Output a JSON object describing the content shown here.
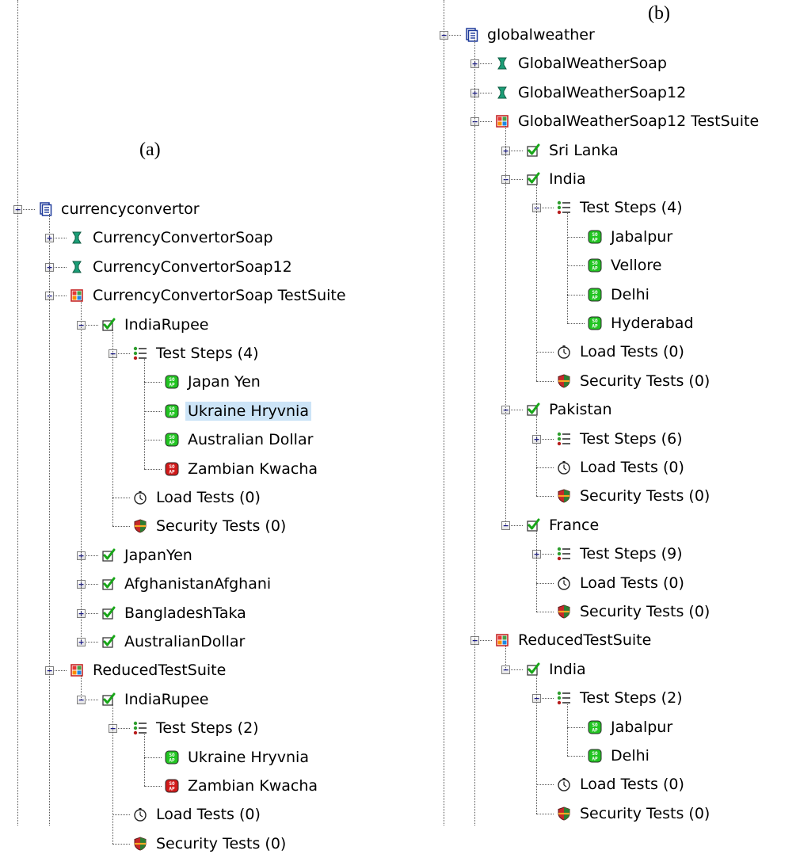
{
  "captions": {
    "a": "(a)",
    "b": "(b)"
  },
  "colors": {
    "selection": "#cce4f7",
    "pass": "#22c422",
    "fail": "#d11a1a",
    "suite": "#c62828",
    "interface": "#1b9e77"
  },
  "tree_a": [
    {
      "label": "currencyconvertor",
      "icon": "project-icon",
      "toggle": "minus"
    },
    {
      "label": "CurrencyConvertorSoap",
      "icon": "interface-icon",
      "toggle": "plus"
    },
    {
      "label": "CurrencyConvertorSoap12",
      "icon": "interface-icon",
      "toggle": "plus"
    },
    {
      "label": "CurrencyConvertorSoap TestSuite",
      "icon": "testsuite-icon",
      "toggle": "minus"
    },
    {
      "label": "IndiaRupee",
      "icon": "testcase-icon",
      "toggle": "minus"
    },
    {
      "label": "Test Steps (4)",
      "icon": "teststeps-icon",
      "toggle": "minus"
    },
    {
      "label": "Japan Yen",
      "icon": "soap-pass-icon"
    },
    {
      "label": "Ukraine Hryvnia",
      "icon": "soap-pass-icon",
      "selected": true
    },
    {
      "label": "Australian Dollar",
      "icon": "soap-pass-icon"
    },
    {
      "label": "Zambian Kwacha",
      "icon": "soap-fail-icon"
    },
    {
      "label": "Load Tests (0)",
      "icon": "stopwatch-icon"
    },
    {
      "label": "Security Tests (0)",
      "icon": "shield-icon"
    },
    {
      "label": "JapanYen",
      "icon": "testcase-icon",
      "toggle": "plus"
    },
    {
      "label": "AfghanistanAfghani",
      "icon": "testcase-icon",
      "toggle": "plus"
    },
    {
      "label": "BangladeshTaka",
      "icon": "testcase-icon",
      "toggle": "plus"
    },
    {
      "label": "AustralianDollar",
      "icon": "testcase-icon",
      "toggle": "plus"
    },
    {
      "label": "ReducedTestSuite",
      "icon": "testsuite-icon",
      "toggle": "minus"
    },
    {
      "label": "IndiaRupee",
      "icon": "testcase-icon",
      "toggle": "minus"
    },
    {
      "label": "Test Steps (2)",
      "icon": "teststeps-icon",
      "toggle": "minus"
    },
    {
      "label": "Ukraine Hryvnia",
      "icon": "soap-pass-icon"
    },
    {
      "label": "Zambian Kwacha",
      "icon": "soap-fail-icon"
    },
    {
      "label": "Load Tests (0)",
      "icon": "stopwatch-icon"
    },
    {
      "label": "Security Tests (0)",
      "icon": "shield-icon"
    }
  ],
  "tree_b": [
    {
      "label": "globalweather",
      "icon": "project-icon",
      "toggle": "minus"
    },
    {
      "label": "GlobalWeatherSoap",
      "icon": "interface-icon",
      "toggle": "plus"
    },
    {
      "label": "GlobalWeatherSoap12",
      "icon": "interface-icon",
      "toggle": "plus"
    },
    {
      "label": "GlobalWeatherSoap12 TestSuite",
      "icon": "testsuite-icon",
      "toggle": "minus"
    },
    {
      "label": "Sri Lanka",
      "icon": "testcase-icon",
      "toggle": "plus"
    },
    {
      "label": "India",
      "icon": "testcase-icon",
      "toggle": "minus"
    },
    {
      "label": "Test Steps (4)",
      "icon": "teststeps-icon",
      "toggle": "minus"
    },
    {
      "label": "Jabalpur",
      "icon": "soap-pass-icon"
    },
    {
      "label": "Vellore",
      "icon": "soap-pass-icon"
    },
    {
      "label": "Delhi",
      "icon": "soap-pass-icon"
    },
    {
      "label": "Hyderabad",
      "icon": "soap-pass-icon"
    },
    {
      "label": "Load Tests (0)",
      "icon": "stopwatch-icon"
    },
    {
      "label": "Security Tests (0)",
      "icon": "shield-icon"
    },
    {
      "label": "Pakistan",
      "icon": "testcase-icon",
      "toggle": "minus"
    },
    {
      "label": "Test Steps (6)",
      "icon": "teststeps-icon",
      "toggle": "plus"
    },
    {
      "label": "Load Tests (0)",
      "icon": "stopwatch-icon"
    },
    {
      "label": "Security Tests (0)",
      "icon": "shield-icon"
    },
    {
      "label": "France",
      "icon": "testcase-icon",
      "toggle": "minus"
    },
    {
      "label": "Test Steps (9)",
      "icon": "teststeps-icon",
      "toggle": "plus"
    },
    {
      "label": "Load Tests (0)",
      "icon": "stopwatch-icon"
    },
    {
      "label": "Security Tests (0)",
      "icon": "shield-icon"
    },
    {
      "label": "ReducedTestSuite",
      "icon": "testsuite-icon",
      "toggle": "minus"
    },
    {
      "label": "India",
      "icon": "testcase-icon",
      "toggle": "minus"
    },
    {
      "label": "Test Steps (2)",
      "icon": "teststeps-icon",
      "toggle": "minus"
    },
    {
      "label": "Jabalpur",
      "icon": "soap-pass-icon"
    },
    {
      "label": "Delhi",
      "icon": "soap-pass-icon"
    },
    {
      "label": "Load Tests (0)",
      "icon": "stopwatch-icon"
    },
    {
      "label": "Security Tests (0)",
      "icon": "shield-icon"
    }
  ]
}
